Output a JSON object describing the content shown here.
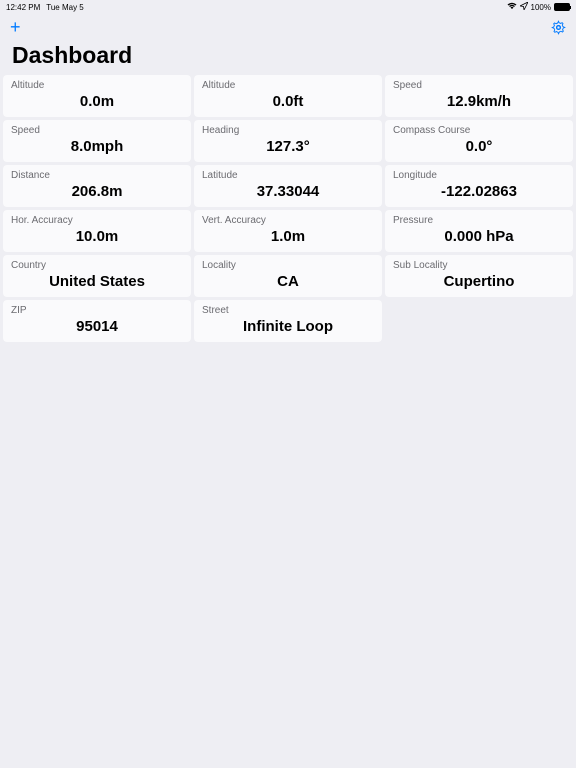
{
  "status": {
    "time": "12:42 PM",
    "date": "Tue May 5",
    "battery": "100%"
  },
  "toolbar": {
    "add": "+"
  },
  "title": "Dashboard",
  "tiles": [
    {
      "label": "Altitude",
      "value": "0.0m"
    },
    {
      "label": "Altitude",
      "value": "0.0ft"
    },
    {
      "label": "Speed",
      "value": "12.9km/h"
    },
    {
      "label": "Speed",
      "value": "8.0mph"
    },
    {
      "label": "Heading",
      "value": "127.3°"
    },
    {
      "label": "Compass Course",
      "value": "0.0°"
    },
    {
      "label": "Distance",
      "value": "206.8m"
    },
    {
      "label": "Latitude",
      "value": "37.33044"
    },
    {
      "label": "Longitude",
      "value": "-122.02863"
    },
    {
      "label": "Hor. Accuracy",
      "value": "10.0m"
    },
    {
      "label": "Vert. Accuracy",
      "value": "1.0m"
    },
    {
      "label": "Pressure",
      "value": "0.000 hPa"
    },
    {
      "label": "Country",
      "value": "United States"
    },
    {
      "label": "Locality",
      "value": "CA"
    },
    {
      "label": "Sub Locality",
      "value": "Cupertino"
    },
    {
      "label": "ZIP",
      "value": "95014"
    },
    {
      "label": "Street",
      "value": "Infinite Loop"
    }
  ]
}
